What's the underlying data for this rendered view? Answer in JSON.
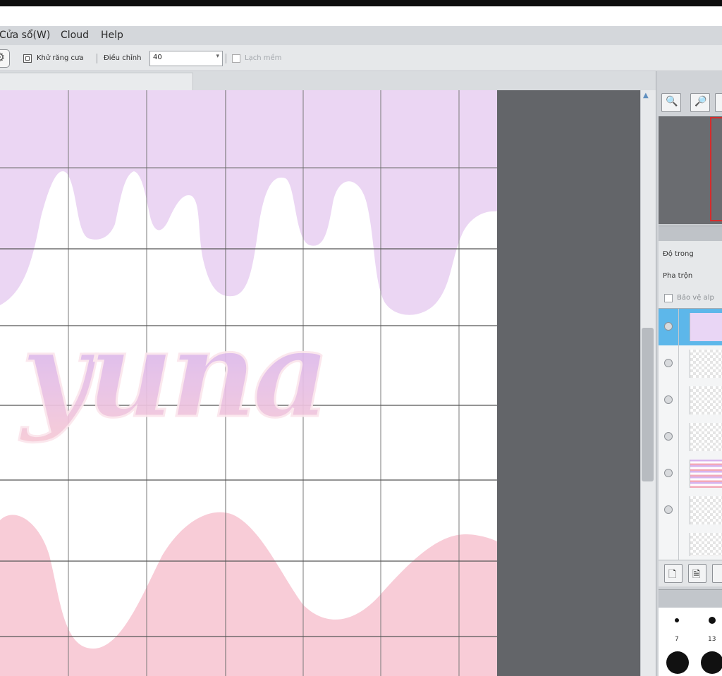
{
  "menu": {
    "items": [
      "Cửa sổ(W)",
      "Cloud",
      "Help"
    ]
  },
  "tool_options": {
    "antialias_label": "Khử răng cưa",
    "adjust_label": "Điều chỉnh",
    "adjust_value": "40",
    "soft_edge_label": "Lạch mềm"
  },
  "canvas": {
    "artwork_text": "yuna",
    "colors": {
      "lavender": "#e9d3f3",
      "pink": "#f8cdd8",
      "grid": "#4a4a4a",
      "text_top": "#cfb0f2",
      "text_bottom": "#f6c8d2"
    }
  },
  "layer_panel": {
    "opacity_label": "Độ trong",
    "blend_label": "Pha trộn",
    "protect_label": "Bảo vệ alp"
  },
  "brushes": {
    "size_labels": [
      "7",
      "13"
    ]
  },
  "icons": {
    "tool_settings": "gear-icon",
    "zoom_fit": "zoom-fit-icon",
    "zoom_in": "zoom-in-icon",
    "new_layer": "new-layer-icon",
    "new_raster": "new-raster-layer-icon"
  }
}
